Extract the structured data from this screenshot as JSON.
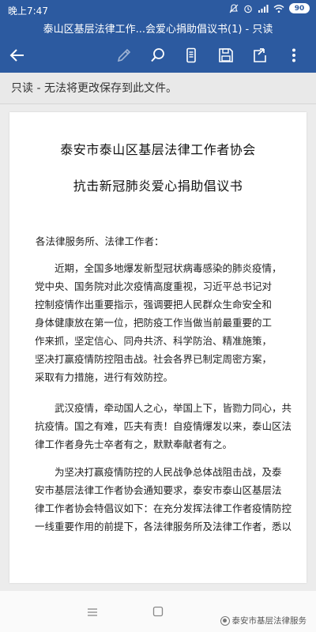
{
  "status_bar": {
    "time": "晚上7:47",
    "battery": "90"
  },
  "title_bar": {
    "title": "泰山区基层法律工作...会爱心捐助倡议书(1) - 只读"
  },
  "toolbar": {
    "icons": [
      "back-arrow-icon",
      "pen-icon",
      "search-icon",
      "mobile-view-icon",
      "save-icon",
      "share-icon",
      "more-icon"
    ]
  },
  "readonly_bar": {
    "text": "只读 - 无法将更改保存到此文件。"
  },
  "document": {
    "heading_1": "泰安市泰山区基层法律工作者协会",
    "heading_2": "抗击新冠肺炎爱心捐助倡议书",
    "salutation": "各法律服务所、法律工作者：",
    "paragraph_1": [
      "近期，全国多地爆发新型冠状病毒感染的肺炎疫情，",
      "党中央、国务院对此次疫情高度重视，习近平总书记对",
      "控制疫情作出重要指示，强调要把人民群众生命安全和",
      "身体健康放在第一位，把防疫工作当做当前最重要的工",
      "作来抓，坚定信心、同舟共济、科学防治、精准施策，",
      "坚决打赢疫情防控阻击战。社会各界已制定周密方案，",
      "采取有力措施，进行有效防控。"
    ],
    "paragraph_2": [
      "武汉疫情，牵动国人之心，举国上下，皆勠力同心，共",
      "抗疫情。国之有难，匹夫有责！自疫情爆发以来，泰山区法",
      "律工作者身先士卒者有之，默默奉献者有之。"
    ],
    "paragraph_3": [
      "为坚决打赢疫情防控的人民战争总体战阻击战，及泰",
      "安市基层法律工作者协会通知要求，泰安市泰山区基层法",
      "律工作者协会特倡议如下：在充分发挥法律工作者疫情防控",
      "一线重要作用的前提下，各法律服务所及法律工作者，悉以"
    ]
  },
  "watermark": {
    "text": "泰安市基层法律服务"
  },
  "colors": {
    "title_bar": "#2c5aa0",
    "readonly_bar": "#e9e9e9"
  }
}
